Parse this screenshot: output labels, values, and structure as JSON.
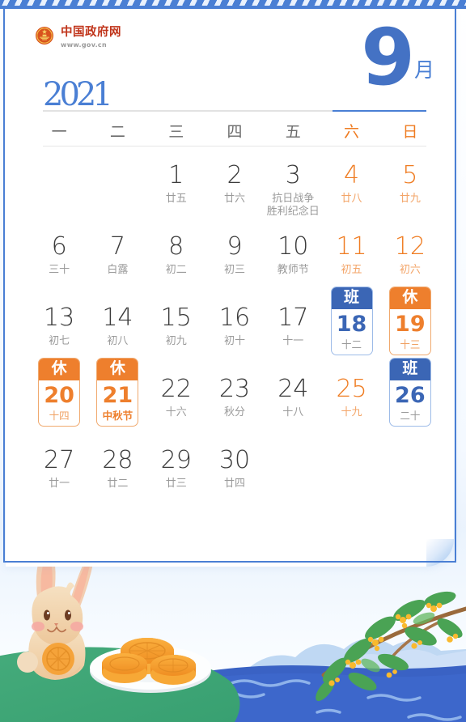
{
  "brand": {
    "name_cn": "中国政府网",
    "url": "www.gov.cn",
    "emblem_icon": "china-national-emblem-icon",
    "brand_color": "#c0341a"
  },
  "header": {
    "year": "2021",
    "month_number": "9",
    "month_char": "月",
    "accent_color": "#4472c4"
  },
  "weekdays": [
    {
      "label": "一",
      "weekend": false
    },
    {
      "label": "二",
      "weekend": false
    },
    {
      "label": "三",
      "weekend": false
    },
    {
      "label": "四",
      "weekend": false
    },
    {
      "label": "五",
      "weekend": false
    },
    {
      "label": "六",
      "weekend": true
    },
    {
      "label": "日",
      "weekend": true
    }
  ],
  "colors": {
    "weekend_orange": "#ef7c22",
    "rest_badge": "#ee7f2d",
    "work_badge": "#3b66b5",
    "frame_blue": "#4a7fd4",
    "grass_green": "#3fa878",
    "water_blue": "#3a62c4"
  },
  "legend": {
    "rest_label": "休",
    "work_label": "班"
  },
  "days": [
    {
      "num": "",
      "sub": "",
      "blank": true
    },
    {
      "num": "",
      "sub": "",
      "blank": true
    },
    {
      "num": "1",
      "sub": "廿五",
      "weekend": false
    },
    {
      "num": "2",
      "sub": "廿六",
      "weekend": false
    },
    {
      "num": "3",
      "sub": "抗日战争\n胜利纪念日",
      "weekend": false,
      "two_line": true
    },
    {
      "num": "4",
      "sub": "廿八",
      "weekend": true
    },
    {
      "num": "5",
      "sub": "廿九",
      "weekend": true
    },
    {
      "num": "6",
      "sub": "三十",
      "weekend": false
    },
    {
      "num": "7",
      "sub": "白露",
      "weekend": false
    },
    {
      "num": "8",
      "sub": "初二",
      "weekend": false
    },
    {
      "num": "9",
      "sub": "初三",
      "weekend": false
    },
    {
      "num": "10",
      "sub": "教师节",
      "weekend": false
    },
    {
      "num": "11",
      "sub": "初五",
      "weekend": true
    },
    {
      "num": "12",
      "sub": "初六",
      "weekend": true
    },
    {
      "num": "13",
      "sub": "初七",
      "weekend": false
    },
    {
      "num": "14",
      "sub": "初八",
      "weekend": false
    },
    {
      "num": "15",
      "sub": "初九",
      "weekend": false
    },
    {
      "num": "16",
      "sub": "初十",
      "weekend": false
    },
    {
      "num": "17",
      "sub": "十一",
      "weekend": false
    },
    {
      "num": "18",
      "sub": "十二",
      "weekend": true,
      "badge": "work",
      "badge_label": "班"
    },
    {
      "num": "19",
      "sub": "十三",
      "weekend": true,
      "badge": "rest",
      "badge_label": "休"
    },
    {
      "num": "20",
      "sub": "十四",
      "weekend": false,
      "badge": "rest",
      "badge_label": "休"
    },
    {
      "num": "21",
      "sub": "中秋节",
      "weekend": false,
      "badge": "rest",
      "badge_label": "休",
      "festival": true
    },
    {
      "num": "22",
      "sub": "十六",
      "weekend": false
    },
    {
      "num": "23",
      "sub": "秋分",
      "weekend": false
    },
    {
      "num": "24",
      "sub": "十八",
      "weekend": false
    },
    {
      "num": "25",
      "sub": "十九",
      "weekend": true
    },
    {
      "num": "26",
      "sub": "二十",
      "weekend": true,
      "badge": "work",
      "badge_label": "班"
    },
    {
      "num": "27",
      "sub": "廿一",
      "weekend": false
    },
    {
      "num": "28",
      "sub": "廿二",
      "weekend": false
    },
    {
      "num": "29",
      "sub": "廿三",
      "weekend": false
    },
    {
      "num": "30",
      "sub": "廿四",
      "weekend": false
    },
    {
      "num": "",
      "sub": "",
      "blank": true
    },
    {
      "num": "",
      "sub": "",
      "blank": true
    },
    {
      "num": "",
      "sub": "",
      "blank": true
    }
  ],
  "illustration": {
    "theme": "mid-autumn-festival",
    "elements": [
      "rabbit-icon",
      "mooncake-plate-icon",
      "osmanthus-branch-icon",
      "water-waves",
      "blue-hills",
      "green-grass"
    ]
  }
}
